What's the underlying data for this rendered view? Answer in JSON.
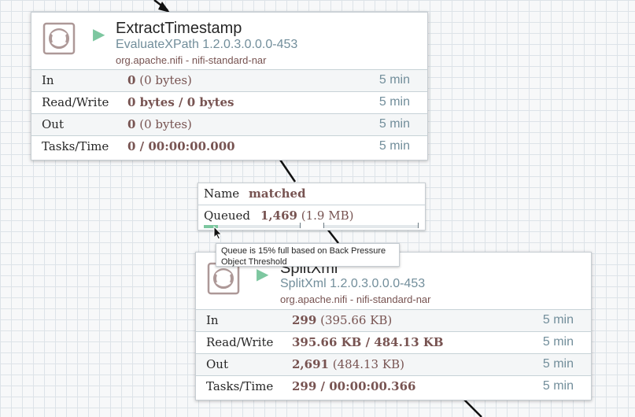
{
  "colors": {
    "accent_green": "#7dc7a0",
    "label_brown": "#775351",
    "type_blue": "#728e9b",
    "border": "#c7d2d7"
  },
  "processors": [
    {
      "name": "ExtractTimestamp",
      "type": "EvaluateXPath 1.2.0.3.0.0.0-453",
      "bundle": "org.apache.nifi - nifi-standard-nar",
      "icon": "processor-icon",
      "run_icon": "play-icon",
      "stats": {
        "in": {
          "label": "In",
          "count": "0",
          "size": "(0 bytes)",
          "time": "5 min"
        },
        "read_write": {
          "label": "Read/Write",
          "value": "0 bytes / 0 bytes",
          "time": "5 min"
        },
        "out": {
          "label": "Out",
          "count": "0",
          "size": "(0 bytes)",
          "time": "5 min"
        },
        "tasks": {
          "label": "Tasks/Time",
          "value": "0 / 00:00:00.000",
          "time": "5 min"
        }
      }
    },
    {
      "name": "SplitXml",
      "type": "SplitXml 1.2.0.3.0.0.0-453",
      "bundle": "org.apache.nifi - nifi-standard-nar",
      "icon": "processor-icon",
      "run_icon": "play-icon",
      "stats": {
        "in": {
          "label": "In",
          "count": "299",
          "size": "(395.66 KB)",
          "time": "5 min"
        },
        "read_write": {
          "label": "Read/Write",
          "value": "395.66 KB / 484.13 KB",
          "time": "5 min"
        },
        "out": {
          "label": "Out",
          "count": "2,691",
          "size": "(484.13 KB)",
          "time": "5 min"
        },
        "tasks": {
          "label": "Tasks/Time",
          "value": "299 / 00:00:00.366",
          "time": "5 min"
        }
      }
    }
  ],
  "connection": {
    "name_label": "Name",
    "name": "matched",
    "queued_label": "Queued",
    "queued_count": "1,469",
    "queued_size": "(1.9 MB)",
    "backpressure_object_fraction": 0.15
  },
  "tooltip": {
    "text": "Queue is 15% full based on Back Pressure Object Threshold"
  }
}
